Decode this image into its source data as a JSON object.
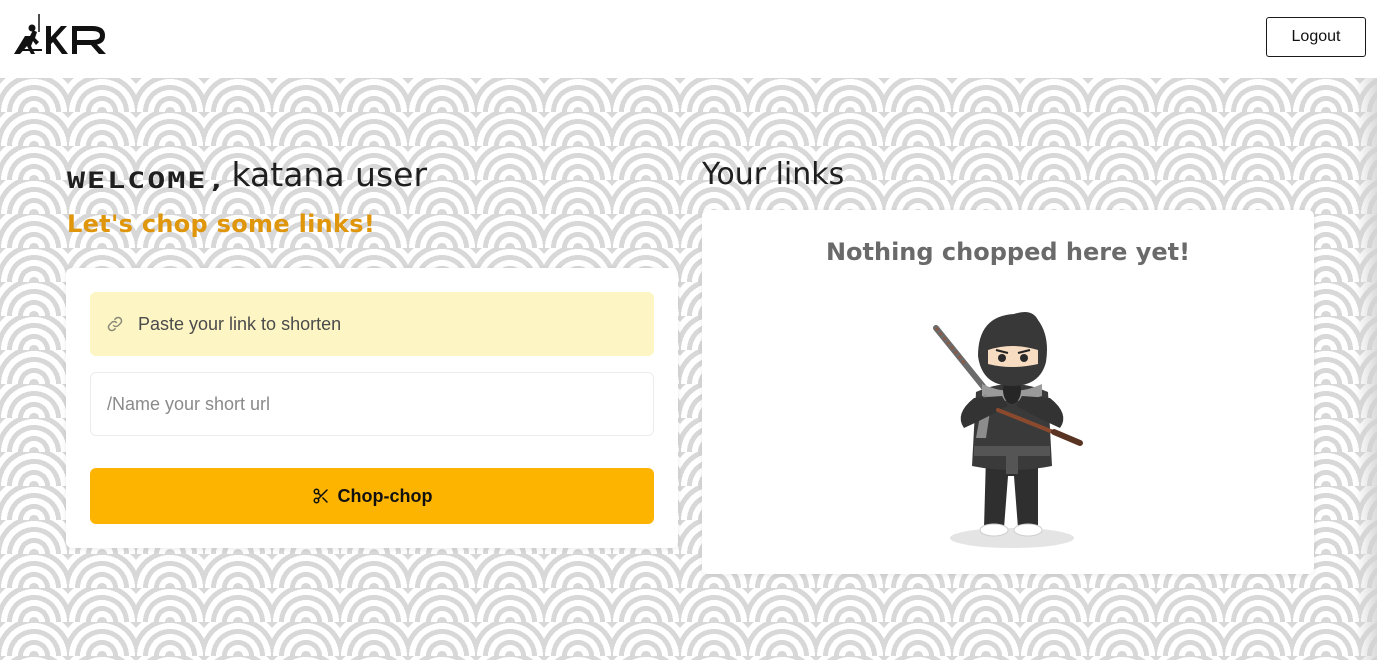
{
  "header": {
    "logo_text": "AKR",
    "logout_label": "Logout"
  },
  "welcome": {
    "greeting": "Welcome,",
    "name": "katana user",
    "subtitle": "Let's chop some links!"
  },
  "form": {
    "url_placeholder": "Paste your link to shorten",
    "name_placeholder": "/Name your short url",
    "submit_label": "Chop-chop"
  },
  "links": {
    "title": "Your links",
    "empty_message": "Nothing chopped here yet!"
  },
  "icons": {
    "link": "link-icon",
    "scissors": "scissors-icon",
    "illustration": "ninja-illustration"
  },
  "colors": {
    "accent": "#fdb400",
    "subtitle": "#e0960b",
    "url_field_bg": "#fdf5c4"
  }
}
